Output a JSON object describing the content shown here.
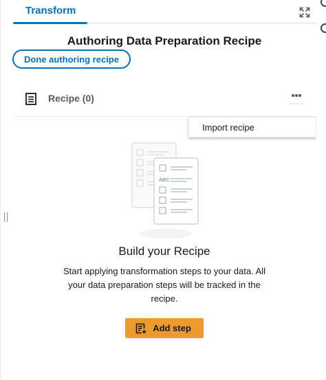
{
  "tabs": {
    "active_label": "Transform"
  },
  "header": {
    "title": "Authoring Data Preparation Recipe",
    "done_button_label": "Done authoring recipe"
  },
  "recipe": {
    "label": "Recipe (0)"
  },
  "menu": {
    "items": [
      "Import recipe"
    ]
  },
  "empty_state": {
    "title": "Build your Recipe",
    "description": "Start applying transformation steps to your data. All your data preparation steps will be tracked in the recipe.",
    "add_button_label": "Add step",
    "illustration_badge": "ABC"
  },
  "icons": {
    "expand": "expand-icon",
    "list": "list-icon",
    "more": "more-options-icon",
    "add": "add-step-icon"
  },
  "colors": {
    "accent": "#0073bb",
    "primary_button": "#ec9a2c",
    "text": "#16191f",
    "muted_text": "#545b64"
  }
}
